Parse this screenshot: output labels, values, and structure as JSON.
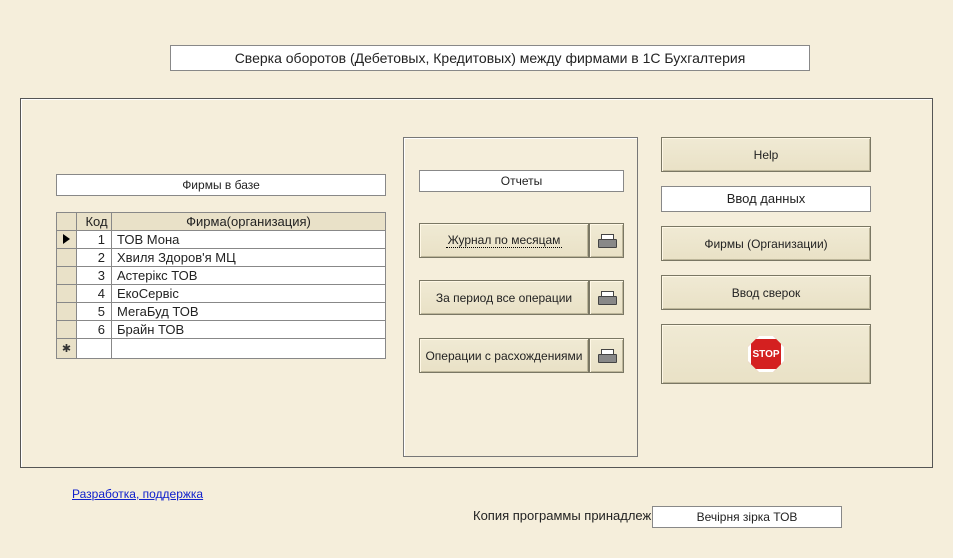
{
  "title": "Сверка оборотов (Дебетовых, Кредитовых) между фирмами в 1С Бухгалтерия",
  "firms": {
    "panel_label": "Фирмы в базе",
    "col_code": "Код",
    "col_name": "Фирма(организация)",
    "rows": [
      {
        "code": "1",
        "name": "ТОВ Мона"
      },
      {
        "code": "2",
        "name": "Хвиля Здоров'я МЦ"
      },
      {
        "code": "3",
        "name": "Астерікс ТОВ"
      },
      {
        "code": "4",
        "name": "ЕкоСервіс"
      },
      {
        "code": "5",
        "name": "МегаБуд ТОВ"
      },
      {
        "code": "6",
        "name": "Брайн ТОВ"
      }
    ]
  },
  "reports": {
    "panel_label": "Отчеты",
    "btn_journal": "Журнал по месяцам",
    "btn_period": "За период все операции",
    "btn_diff": "Операции с расхождениями"
  },
  "right": {
    "help": "Help",
    "data_entry": "Ввод данных",
    "firms_org": "Фирмы (Организации)",
    "input_sverok": "Ввод сверок",
    "stop": "STOP"
  },
  "footer": {
    "dev_link": "Разработка, поддержка",
    "owner_label": "Копия программы принадлежит",
    "owner_value": "Вечірня зірка ТОВ"
  }
}
